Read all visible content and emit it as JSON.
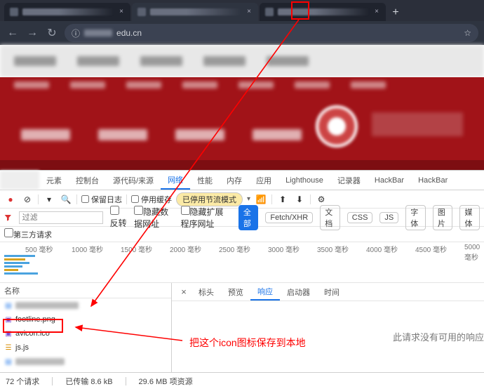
{
  "browser": {
    "new_tab_label": "+",
    "tab_close": "×",
    "url_domain": "edu.cn",
    "nav": {
      "back": "←",
      "forward": "→",
      "reload": "↻"
    }
  },
  "devtools": {
    "tabs": [
      "元素",
      "控制台",
      "源代码/来源",
      "网络",
      "性能",
      "内存",
      "应用",
      "Lighthouse",
      "记录器",
      "HackBar",
      "HackBar"
    ],
    "active_tab_index": 3,
    "toolbar": {
      "preserve_log": "保留日志",
      "disable_cache": "停用缓存",
      "throttling_chip": "已停用节流模式",
      "gear": "⚙"
    },
    "filterbar": {
      "filter_placeholder": "过滤",
      "invert": "反转",
      "hide_data_urls": "隐藏数据网址",
      "hide_ext_urls": "隐藏扩展程序网址",
      "types": [
        "全部",
        "Fetch/XHR",
        "文档",
        "CSS",
        "JS",
        "字体",
        "图片",
        "媒体"
      ],
      "active_type_index": 0
    },
    "third_party": "第三方请求",
    "timeline_ticks": [
      "500 毫秒",
      "1000 毫秒",
      "1500 毫秒",
      "2000 毫秒",
      "2500 毫秒",
      "3000 毫秒",
      "3500 毫秒",
      "4000 毫秒",
      "4500 毫秒",
      "5000 毫秒"
    ],
    "name_header": "名称",
    "requests": [
      {
        "icon": "doc",
        "name": "",
        "blur": true
      },
      {
        "icon": "img",
        "name": "footline.png"
      },
      {
        "icon": "img",
        "name": "avicon.ico"
      },
      {
        "icon": "js",
        "name": "js.js"
      },
      {
        "icon": "doc",
        "name": "",
        "blur": true
      }
    ],
    "detail_tabs": [
      "标头",
      "预览",
      "响应",
      "启动器",
      "时间"
    ],
    "detail_active_index": 2,
    "detail_close": "×",
    "no_response": "此请求没有可用的响应",
    "status": {
      "requests": "72 个请求",
      "transferred": "已传输 8.6 kB",
      "resources": "29.6 MB 项资源"
    }
  },
  "annotation": {
    "text": "把这个icon图标保存到本地"
  }
}
